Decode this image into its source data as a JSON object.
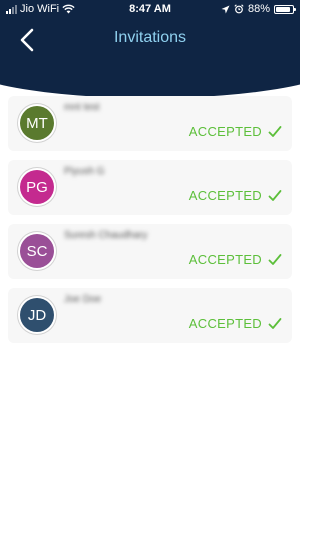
{
  "status_bar": {
    "carrier": "Jio WiFi",
    "time": "8:47 AM",
    "battery": "88%",
    "battery_level": 0.88
  },
  "header": {
    "title": "Invitations",
    "background_color": "#0f2544",
    "title_color": "#8fd0ee"
  },
  "invitations": [
    {
      "initials": "MT",
      "name": "mnt test",
      "status": "ACCEPTED",
      "avatar_color": "#5a7a2e"
    },
    {
      "initials": "PG",
      "name": "Piyush G",
      "status": "ACCEPTED",
      "avatar_color": "#c42a8f"
    },
    {
      "initials": "SC",
      "name": "Suresh Chaudhary",
      "status": "ACCEPTED",
      "avatar_color": "#9a4f97"
    },
    {
      "initials": "JD",
      "name": "Joe Doe",
      "status": "ACCEPTED",
      "avatar_color": "#2f4f6e"
    }
  ],
  "accepted_color": "#5cbf3a"
}
